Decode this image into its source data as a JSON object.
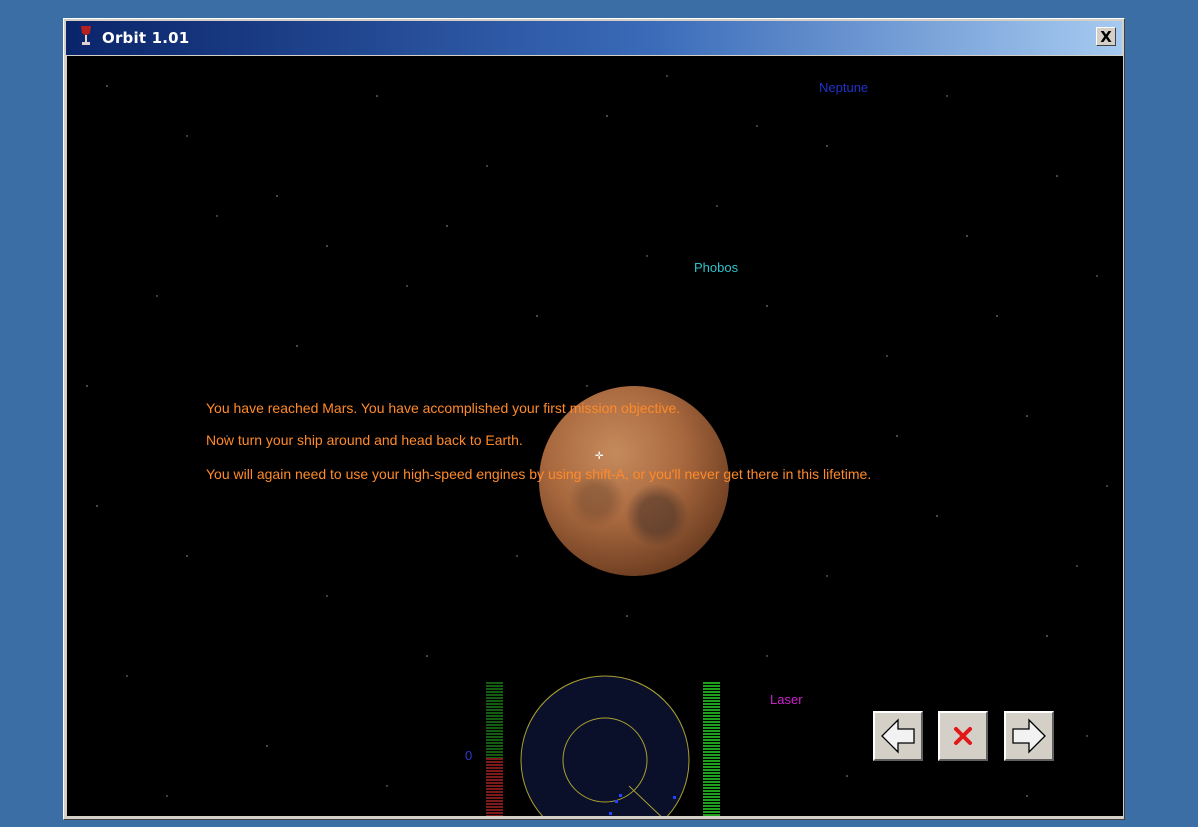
{
  "window": {
    "title": "Orbit 1.01",
    "close_label": "X"
  },
  "space_labels": {
    "neptune": "Neptune",
    "phobos": "Phobos",
    "weapon": "Laser"
  },
  "messages": [
    "You have reached Mars. You have accomplished your first mission objective.",
    "Now turn your ship around and head back to Earth.",
    "You will again need to use your high-speed engines by using shift-A, or you'll never get there in this lifetime."
  ],
  "hud": {
    "gauge_value": "0"
  },
  "nav_buttons": {
    "prev_icon": "left-arrow-icon",
    "stop_icon": "red-x-icon",
    "next_icon": "right-arrow-icon"
  },
  "colors": {
    "message": "#ff8a2a",
    "neptune": "#2233cc",
    "phobos": "#30c0c8",
    "laser": "#cc22cc",
    "radar": "#a8a030",
    "radar_blip": "#2244ff",
    "gauge_green": "#1ea01e",
    "gauge_red": "#7a1a1a"
  }
}
